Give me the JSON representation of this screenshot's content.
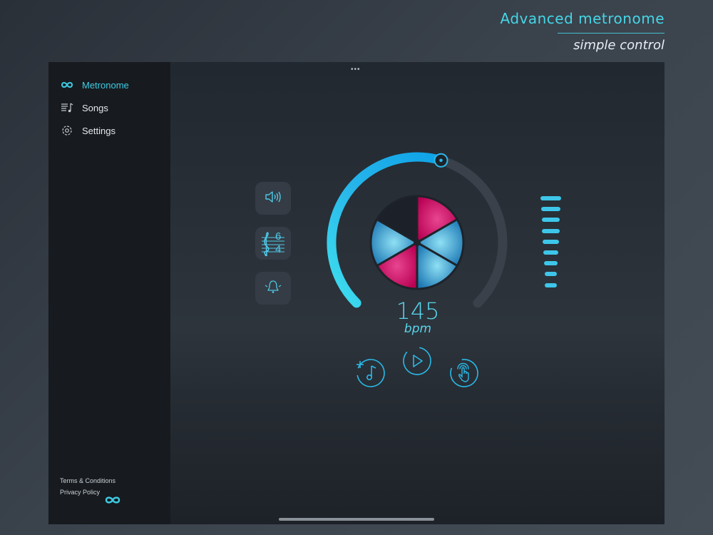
{
  "promo": {
    "title": "Advanced metronome",
    "subtitle": "simple control"
  },
  "sidebar": {
    "items": [
      {
        "label": "Metronome",
        "icon": "infinity-icon",
        "active": true
      },
      {
        "label": "Songs",
        "icon": "songs-list-icon",
        "active": false
      },
      {
        "label": "Settings",
        "icon": "gear-icon",
        "active": false
      }
    ],
    "terms": "Terms & Conditions",
    "privacy": "Privacy Policy",
    "logo_icon": "infinity-logo-icon"
  },
  "main": {
    "top_handle": "•••",
    "time_signature": {
      "top": "6",
      "bottom": "4"
    },
    "tempo": {
      "bpm": "145",
      "unit": "bpm"
    },
    "tempo_dial_fraction": 0.56,
    "beat_segments": 6,
    "volume_level_bars": 9
  },
  "colors": {
    "accent": "#3ecbe2",
    "beat_accent": "#d6005f",
    "beat_normal": "#4aa8d8",
    "beat_muted": "#1b2029"
  }
}
